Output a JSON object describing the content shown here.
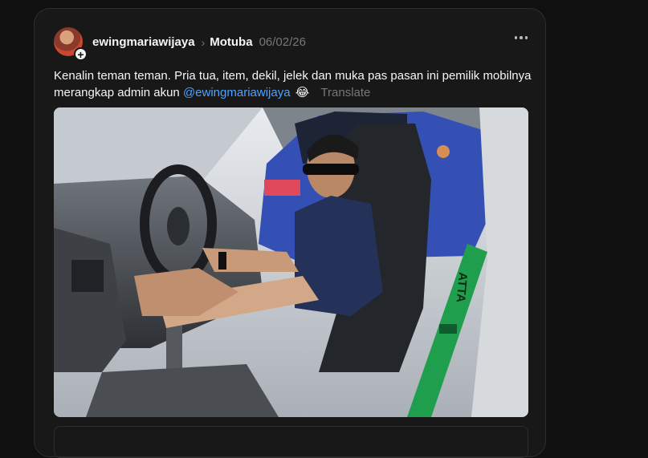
{
  "post": {
    "username": "ewingmariawijaya",
    "community": "Motuba",
    "date": "06/02/26",
    "text_part1": "Kenalin teman teman. Pria tua, item, dekil, jelek dan muka pas pasan ini pemilik mobilnya merangkap admin akun ",
    "mention": "@ewingmariawijaya",
    "emoji": "😂",
    "translate_label": "Translate",
    "seat_belt_text": "ATTA"
  }
}
